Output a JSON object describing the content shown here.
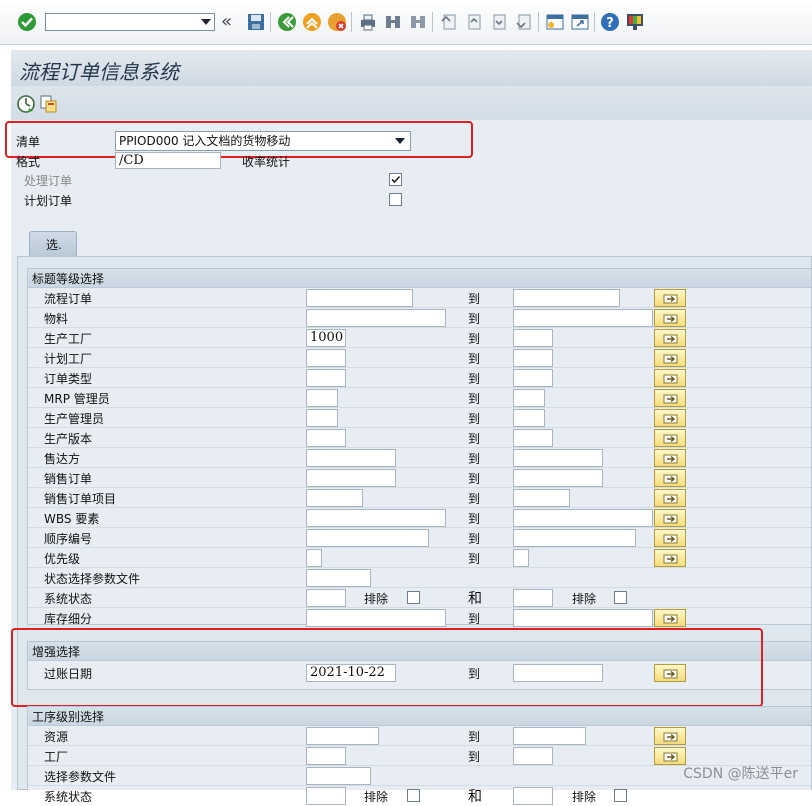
{
  "window": {
    "title": "流程订单信息系统"
  },
  "toolbar": {
    "icons": [
      "enter-icon",
      "command-field",
      "back-double-arrow-icon",
      "save-icon",
      "back-icon",
      "exit-icon",
      "cancel-icon",
      "print-icon",
      "find-icon",
      "find-next-icon",
      "first-page-icon",
      "previous-page-icon",
      "next-page-icon",
      "last-page-icon",
      "new-session-icon",
      "shortcut-icon",
      "help-icon",
      "customize-layout-icon"
    ],
    "colors": {
      "enter": "#2e9a35",
      "back": "#3a9a3a",
      "exit": "#f0a020",
      "cancel": "#d83a2a",
      "help": "#2f6fb8"
    }
  },
  "app_toolbar": {
    "icons": [
      "execute-icon",
      "get-variant-icon"
    ]
  },
  "header_fields": {
    "list_label": "清单",
    "list_value": "PPIOD000 记入文档的货物移动",
    "format_label": "格式",
    "format_value": "/CD",
    "format_desc": "收率统计",
    "process_orders_label": "处理订单",
    "process_orders_checked": true,
    "planned_orders_label": "计划订单",
    "planned_orders_checked": false
  },
  "tab": {
    "label": "选."
  },
  "groups": {
    "header_level": {
      "title": "标题等级选择",
      "rows": [
        {
          "label": "流程订单",
          "from": "",
          "to_label": "到",
          "to": ""
        },
        {
          "label": "物料",
          "from": "",
          "to_label": "到",
          "to": ""
        },
        {
          "label": "生产工厂",
          "from": "1000",
          "to_label": "到",
          "to": ""
        },
        {
          "label": "计划工厂",
          "from": "",
          "to_label": "到",
          "to": ""
        },
        {
          "label": "订单类型",
          "from": "",
          "to_label": "到",
          "to": ""
        },
        {
          "label": "MRP 管理员",
          "from": "",
          "to_label": "到",
          "to": ""
        },
        {
          "label": "生产管理员",
          "from": "",
          "to_label": "到",
          "to": ""
        },
        {
          "label": "生产版本",
          "from": "",
          "to_label": "到",
          "to": ""
        },
        {
          "label": "售达方",
          "from": "",
          "to_label": "到",
          "to": ""
        },
        {
          "label": "销售订单",
          "from": "",
          "to_label": "到",
          "to": ""
        },
        {
          "label": "销售订单项目",
          "from": "",
          "to_label": "到",
          "to": ""
        },
        {
          "label": "WBS 要素",
          "from": "",
          "to_label": "到",
          "to": ""
        },
        {
          "label": "顺序编号",
          "from": "",
          "to_label": "到",
          "to": ""
        },
        {
          "label": "优先级",
          "from": "",
          "to_label": "到",
          "to": ""
        },
        {
          "label": "状态选择参数文件",
          "from": ""
        },
        {
          "label": "系统状态",
          "from": "",
          "exclude_label": "排除",
          "and_label": "和",
          "to": "",
          "exclude2_label": "排除"
        },
        {
          "label": "库存细分",
          "from": "",
          "to_label": "到",
          "to": ""
        }
      ]
    },
    "enhanced": {
      "title": "增强选择",
      "rows": [
        {
          "label": "过账日期",
          "from": "2021-10-22",
          "to_label": "到",
          "to": ""
        }
      ]
    },
    "operation_level": {
      "title": "工序级别选择",
      "rows": [
        {
          "label": "资源",
          "from": "",
          "to_label": "到",
          "to": ""
        },
        {
          "label": "工厂",
          "from": "",
          "to_label": "到",
          "to": ""
        },
        {
          "label": "选择参数文件",
          "from": ""
        },
        {
          "label": "系统状态",
          "from": "",
          "exclude_label": "排除",
          "and_label": "和",
          "to": "",
          "exclude2_label": "排除"
        }
      ]
    }
  },
  "highlight_color": "#e02020",
  "watermark": "CSDN @陈送平er"
}
